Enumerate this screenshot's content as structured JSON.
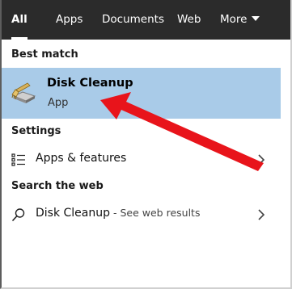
{
  "tabs": [
    {
      "label": "All",
      "active": true
    },
    {
      "label": "Apps",
      "active": false
    },
    {
      "label": "Documents",
      "active": false
    },
    {
      "label": "Web",
      "active": false
    },
    {
      "label": "More",
      "active": false
    }
  ],
  "best_match": {
    "header": "Best match",
    "title": "Disk Cleanup",
    "subtitle": "App",
    "icon": "disk-cleanup-icon"
  },
  "settings": {
    "header": "Settings",
    "items": [
      {
        "label": "Apps & features",
        "icon": "list-icon"
      }
    ]
  },
  "web": {
    "header": "Search the web",
    "items": [
      {
        "label": "Disk Cleanup",
        "suffix": " - See web results",
        "icon": "search-icon"
      }
    ]
  },
  "colors": {
    "topbar": "#2b2b2b",
    "highlight": "#a9cbe8",
    "annotation_arrow": "#e8141b"
  }
}
